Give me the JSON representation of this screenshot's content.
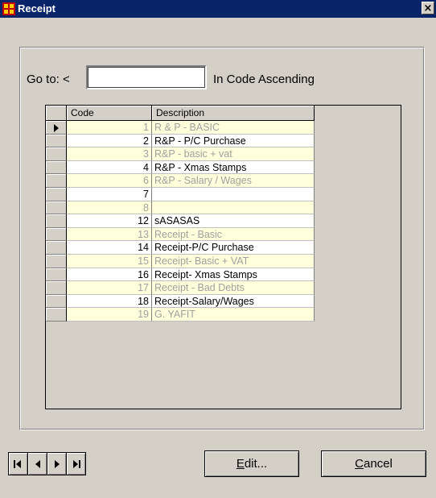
{
  "window": {
    "title": "Receipt",
    "close_glyph": "×"
  },
  "goto": {
    "label": "Go to: <",
    "value": "",
    "order_label": "In Code Ascending"
  },
  "grid": {
    "columns": [
      "Code",
      "Description"
    ],
    "selected_row": 0,
    "rows": [
      {
        "code": "1",
        "description": "R & P - BASIC"
      },
      {
        "code": "2",
        "description": "R&P -  P/C Purchase"
      },
      {
        "code": "3",
        "description": "R&P -  basic + vat"
      },
      {
        "code": "4",
        "description": "R&P - Xmas Stamps"
      },
      {
        "code": "6",
        "description": "R&P - Salary / Wages"
      },
      {
        "code": "7",
        "description": ""
      },
      {
        "code": "8",
        "description": ""
      },
      {
        "code": "12",
        "description": "sASASAS"
      },
      {
        "code": "13",
        "description": "Receipt -  Basic"
      },
      {
        "code": "14",
        "description": "Receipt-P/C Purchase"
      },
      {
        "code": "15",
        "description": "Receipt- Basic + VAT"
      },
      {
        "code": "16",
        "description": "Receipt- Xmas Stamps"
      },
      {
        "code": "17",
        "description": "Receipt -  Bad Debts"
      },
      {
        "code": "18",
        "description": "Receipt-Salary/Wages"
      },
      {
        "code": "19",
        "description": "G. YAFIT"
      }
    ]
  },
  "buttons": {
    "edit_accel": "E",
    "edit_rest": "dit...",
    "cancel_accel": "C",
    "cancel_rest": "ancel"
  },
  "nav_icons": [
    "first-record-icon",
    "previous-record-icon",
    "next-record-icon",
    "last-record-icon"
  ],
  "colors": {
    "titlebar": "#0a246a",
    "face": "#d4d0c8",
    "alt_row": "#ffffdc",
    "alt_row_text": "#a0a0a0"
  }
}
